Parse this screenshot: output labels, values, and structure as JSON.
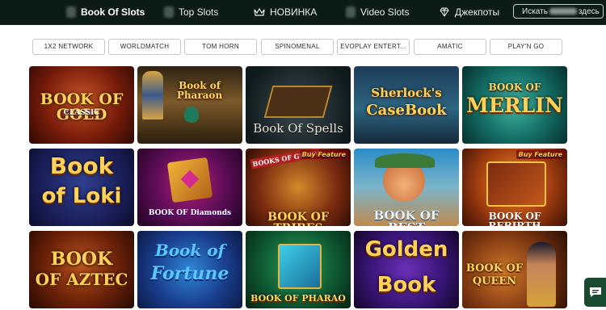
{
  "nav": {
    "items": [
      {
        "label": "Book Of Slots",
        "icon": "book-icon"
      },
      {
        "label": "Top Slots",
        "icon": "number-seven-icon"
      },
      {
        "label": "НОВИНКА",
        "icon": "crown-icon"
      },
      {
        "label": "Video Slots",
        "icon": "slot-icon"
      },
      {
        "label": "Джекпоты",
        "icon": "diamond-icon"
      }
    ],
    "search_prefix": "Искать",
    "search_suffix": "здесь"
  },
  "providers": [
    "1X2 NETWORK",
    "WORLDMATCH",
    "TOM HORN",
    "SPINOMENAL",
    "EVOPLAY ENTERT...",
    "AMATIC",
    "PLAY'N GO"
  ],
  "games": [
    {
      "line1": "BOOK OF GOLD",
      "line2": "CLASSIC"
    },
    {
      "line1": "Book of Pharaon",
      "line2": ""
    },
    {
      "line1": "Book Of Spells",
      "line2": ""
    },
    {
      "line1": "Sherlock's",
      "line2": "CaseBook"
    },
    {
      "line1": "BOOK OF",
      "line2": "MERLIN"
    },
    {
      "line1": "Book",
      "line2": "of Loki"
    },
    {
      "line1": "BOOK OF Diamonds",
      "line2": ""
    },
    {
      "line1": "BOOK OF TRIBES",
      "line2": "BOOKS OF GLORY"
    },
    {
      "line1": "BOOK OF REST",
      "line2": ""
    },
    {
      "line1": "BOOK OF REBIRTH",
      "line2": ""
    },
    {
      "line1": "BOOK",
      "line2": "OF AZTEC"
    },
    {
      "line1": "Book of",
      "line2": "Fortune"
    },
    {
      "line1": "BOOK OF PHARAO",
      "line2": ""
    },
    {
      "line1": "Golden",
      "line2": "Book"
    },
    {
      "line1": "BOOK OF",
      "line2": "QUEEN"
    }
  ],
  "badges": {
    "buy_feature": "Buy Feature"
  },
  "colors": {
    "topbar": "#0d1b17",
    "accent": "#174a2f"
  }
}
